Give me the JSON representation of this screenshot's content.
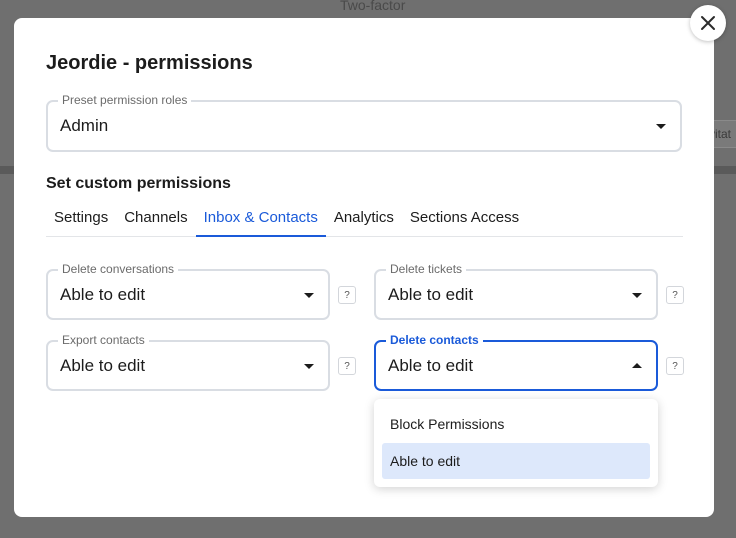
{
  "background": {
    "title": "Two-factor",
    "pill_text": "vitat"
  },
  "modal": {
    "title": "Jeordie - permissions",
    "preset": {
      "label": "Preset permission roles",
      "value": "Admin"
    },
    "section_heading": "Set custom permissions",
    "tabs": [
      {
        "label": "Settings"
      },
      {
        "label": "Channels"
      },
      {
        "label": "Inbox & Contacts"
      },
      {
        "label": "Analytics"
      },
      {
        "label": "Sections Access"
      }
    ],
    "active_tab": "Inbox & Contacts",
    "permissions": {
      "delete_conversations": {
        "label": "Delete conversations",
        "value": "Able to edit"
      },
      "delete_tickets": {
        "label": "Delete tickets",
        "value": "Able to edit"
      },
      "export_contacts": {
        "label": "Export contacts",
        "value": "Able to edit"
      },
      "delete_contacts": {
        "label": "Delete contacts",
        "value": "Able to edit"
      }
    },
    "help_glyph": "?",
    "dropdown": {
      "options": [
        {
          "label": "Block Permissions"
        },
        {
          "label": "Able to edit"
        }
      ],
      "selected": "Able to edit"
    }
  },
  "colors": {
    "accent": "#1a5ad9",
    "overlay": "#6f6f6f",
    "selected_option_bg": "#dde8fb"
  },
  "icons": {
    "close": "close-icon",
    "caret": "chevron-down-icon"
  }
}
